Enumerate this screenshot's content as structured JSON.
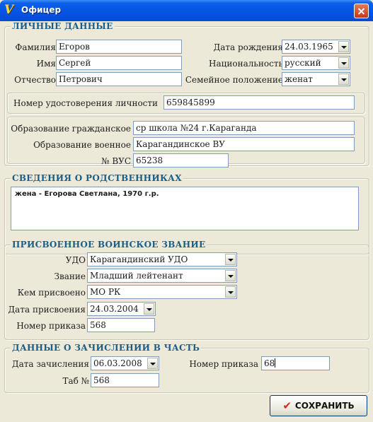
{
  "window": {
    "title": "Офицер",
    "icon_letter": "V"
  },
  "personal": {
    "legend": "ЛИЧНЫЕ ДАННЫЕ",
    "surname": {
      "label": "Фамилия",
      "value": "Егоров"
    },
    "name": {
      "label": "Имя",
      "value": "Сергей"
    },
    "patronymic": {
      "label": "Отчество",
      "value": "Петрович"
    },
    "birth_date": {
      "label": "Дата рождения",
      "value": "24.03.1965"
    },
    "nationality": {
      "label": "Национальность",
      "value": "русский"
    },
    "marital": {
      "label": "Семейное положение",
      "value": "женат"
    },
    "id_number": {
      "label": "Номер удостоверения личности",
      "value": "659845899"
    },
    "edu_civil": {
      "label": "Образование гражданское",
      "value": "ср школа №24 г.Караганда"
    },
    "edu_military": {
      "label": "Образование военное",
      "value": "Карагандинское ВУ"
    },
    "vus": {
      "label": "№ ВУС",
      "value": "65238"
    }
  },
  "relatives": {
    "legend": "СВЕДЕНИЯ О РОДСТВЕННИКАХ",
    "text": "жена - Егорова Светлана, 1970 г.р."
  },
  "rank": {
    "legend": "ПРИСВОЕННОЕ ВОИНСКОЕ ЗВАНИЕ",
    "udo": {
      "label": "УДО",
      "value": "Карагандинский УДО"
    },
    "title": {
      "label": "Звание",
      "value": "Младший лейтенант"
    },
    "assigned_by": {
      "label": "Кем присвоено",
      "value": "МО РК"
    },
    "date": {
      "label": "Дата присвоения",
      "value": "24.03.2004"
    },
    "order_no": {
      "label": "Номер приказа",
      "value": "568"
    }
  },
  "enrollment": {
    "legend": "ДАННЫЕ О ЗАЧИСЛЕНИИ В ЧАСТЬ",
    "date": {
      "label": "Дата зачисления",
      "value": "06.03.2008"
    },
    "order_no": {
      "label": "Номер приказа",
      "value": "68"
    },
    "tab_no": {
      "label": "Таб №",
      "value": "568"
    }
  },
  "save_button": {
    "label": "СОХРАНИТЬ"
  },
  "colors": {
    "legend": "#1a5e88",
    "accent_check": "#d62a1c",
    "titlebar": "#0554e3"
  }
}
